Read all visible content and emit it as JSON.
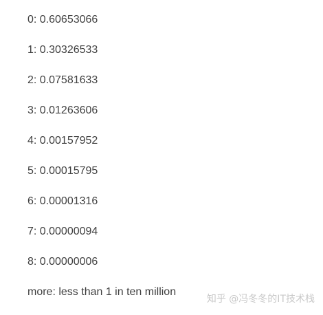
{
  "lines": [
    "0: 0.60653066",
    "1: 0.30326533",
    "2: 0.07581633",
    "3: 0.01263606",
    "4: 0.00157952",
    "5: 0.00015795",
    "6: 0.00001316",
    "7: 0.00000094",
    "8: 0.00000006",
    "more: less than 1 in ten million"
  ],
  "watermark": "知乎 @冯冬冬的IT技术栈",
  "colors": {
    "text": "#404040",
    "watermark": "#c8c8c8",
    "background": "#ffffff"
  }
}
